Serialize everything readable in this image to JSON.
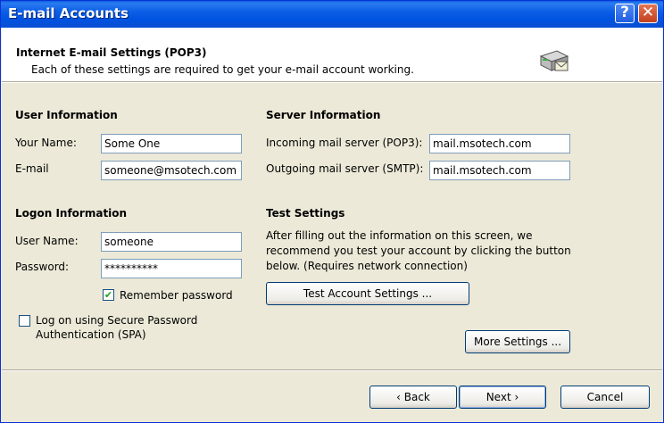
{
  "window": {
    "title": "E-mail Accounts",
    "help_label": "?",
    "close_label": "✕"
  },
  "header": {
    "title": "Internet E-mail Settings (POP3)",
    "subtitle": "Each of these settings are required to get your e-mail account working.",
    "icon": "mail-server-icon"
  },
  "user_info": {
    "heading": "User Information",
    "name_label": "Your Name:",
    "name_value": "Some One",
    "email_label": "E-mail",
    "email_value": "someone@msotech.com"
  },
  "logon_info": {
    "heading": "Logon Information",
    "username_label": "User Name:",
    "username_value": "someone",
    "password_label": "Password:",
    "password_value": "**********",
    "remember_label": "Remember password",
    "remember_checked": true,
    "spa_label_line1": "Log on using Secure Password",
    "spa_label_line2": "Authentication (SPA)",
    "spa_checked": false
  },
  "server_info": {
    "heading": "Server Information",
    "incoming_label": "Incoming mail server (POP3):",
    "incoming_value": "mail.msotech.com",
    "outgoing_label": "Outgoing mail server (SMTP):",
    "outgoing_value": "mail.msotech.com"
  },
  "test_settings": {
    "heading": "Test Settings",
    "desc_line1": "After filling out the information on this screen, we",
    "desc_line2": "recommend you test your account by clicking the button",
    "desc_line3": "below. (Requires network connection)",
    "button_label": "Test Account Settings ..."
  },
  "buttons": {
    "more_settings": "More Settings ...",
    "back": "‹ Back",
    "next": "Next ›",
    "cancel": "Cancel"
  }
}
